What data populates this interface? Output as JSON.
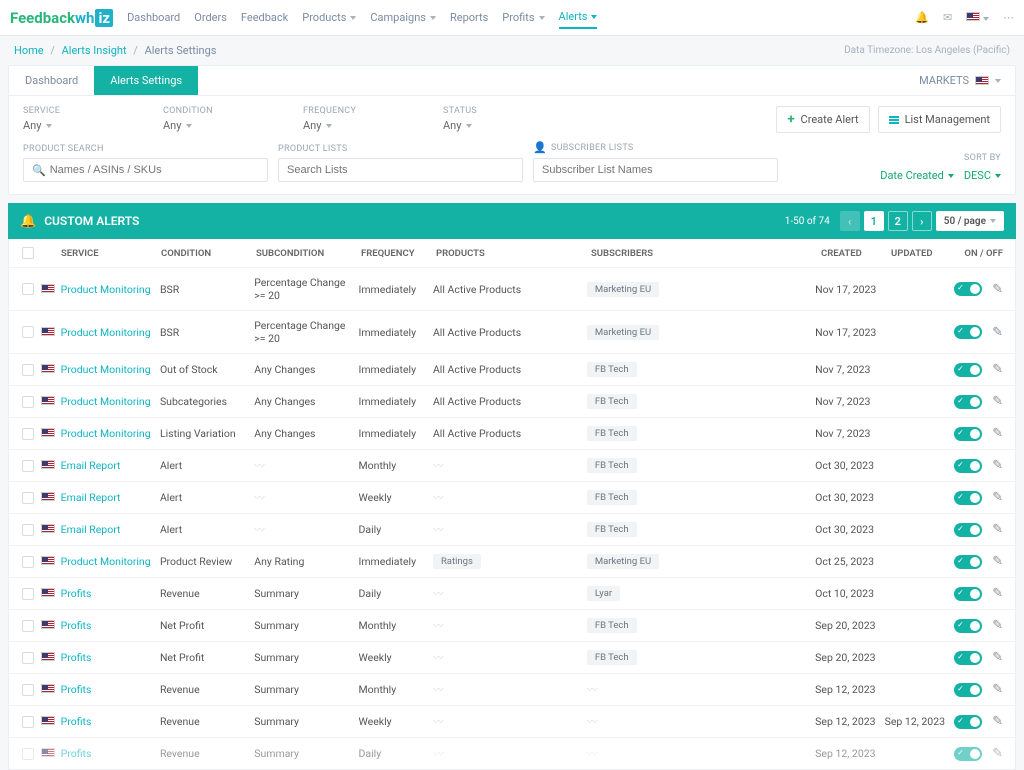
{
  "brand": {
    "part1": "Feedback",
    "part2": "wh",
    "part3": "iz"
  },
  "nav": {
    "items": [
      {
        "label": "Dashboard",
        "caret": false
      },
      {
        "label": "Orders",
        "caret": false
      },
      {
        "label": "Feedback",
        "caret": false
      },
      {
        "label": "Products",
        "caret": true
      },
      {
        "label": "Campaigns",
        "caret": true
      },
      {
        "label": "Reports",
        "caret": false
      },
      {
        "label": "Profits",
        "caret": true
      },
      {
        "label": "Alerts",
        "caret": true,
        "active": true
      }
    ]
  },
  "breadcrumb": {
    "home": "Home",
    "insight": "Alerts Insight",
    "current": "Alerts Settings"
  },
  "timezone": "Data Timezone: Los Angeles (Pacific)",
  "tabs": {
    "dashboard": "Dashboard",
    "settings": "Alerts Settings"
  },
  "markets_label": "MARKETS",
  "filters": {
    "service": {
      "label": "SERVICE",
      "value": "Any"
    },
    "condition": {
      "label": "CONDITION",
      "value": "Any"
    },
    "frequency": {
      "label": "FREQUENCY",
      "value": "Any"
    },
    "status": {
      "label": "STATUS",
      "value": "Any"
    }
  },
  "buttons": {
    "create": "Create Alert",
    "list_mgmt": "List Management"
  },
  "search": {
    "product_label": "PRODUCT SEARCH",
    "product_placeholder": "Names / ASINs / SKUs",
    "lists_label": "PRODUCT LISTS",
    "lists_placeholder": "Search Lists",
    "subs_label": "SUBSCRIBER LISTS",
    "subs_placeholder": "Subscriber List Names",
    "sort_label": "SORT BY",
    "sort_field": "Date Created",
    "sort_dir": "DESC"
  },
  "grid": {
    "title": "CUSTOM ALERTS",
    "range": "1-50 of 74",
    "page1": "1",
    "page2": "2",
    "page_size": "50 / page"
  },
  "columns": {
    "service": "Service",
    "condition": "Condition",
    "subcondition": "Subcondition",
    "frequency": "Frequency",
    "products": "Products",
    "subscribers": "Subscribers",
    "created": "Created",
    "updated": "Updated",
    "onoff": "On / Off"
  },
  "rows": [
    {
      "service": "Product Monitoring",
      "condition": "BSR",
      "sub": "Percentage Change   >= 20",
      "freq": "Immediately",
      "products": "All Active Products",
      "products_chip": false,
      "subs": "Marketing EU",
      "created": "Nov 17, 2023",
      "updated": ""
    },
    {
      "service": "Product Monitoring",
      "condition": "BSR",
      "sub": "Percentage Change   >= 20",
      "freq": "Immediately",
      "products": "All Active Products",
      "products_chip": false,
      "subs": "Marketing EU",
      "created": "Nov 17, 2023",
      "updated": ""
    },
    {
      "service": "Product Monitoring",
      "condition": "Out of Stock",
      "sub": "Any Changes",
      "freq": "Immediately",
      "products": "All Active Products",
      "products_chip": false,
      "subs": "FB Tech",
      "created": "Nov 7, 2023",
      "updated": ""
    },
    {
      "service": "Product Monitoring",
      "condition": "Subcategories",
      "sub": "Any Changes",
      "freq": "Immediately",
      "products": "All Active Products",
      "products_chip": false,
      "subs": "FB Tech",
      "created": "Nov 7, 2023",
      "updated": ""
    },
    {
      "service": "Product Monitoring",
      "condition": "Listing Variation",
      "sub": "Any Changes",
      "freq": "Immediately",
      "products": "All Active Products",
      "products_chip": false,
      "subs": "FB Tech",
      "created": "Nov 7, 2023",
      "updated": ""
    },
    {
      "service": "Email Report",
      "condition": "Alert",
      "sub": "~",
      "sub_tilde": true,
      "freq": "Monthly",
      "products": "~",
      "products_tilde": true,
      "subs": "FB Tech",
      "created": "Oct 30, 2023",
      "updated": ""
    },
    {
      "service": "Email Report",
      "condition": "Alert",
      "sub": "~",
      "sub_tilde": true,
      "freq": "Weekly",
      "products": "~",
      "products_tilde": true,
      "subs": "FB Tech",
      "created": "Oct 30, 2023",
      "updated": ""
    },
    {
      "service": "Email Report",
      "condition": "Alert",
      "sub": "~",
      "sub_tilde": true,
      "freq": "Daily",
      "products": "~",
      "products_tilde": true,
      "subs": "FB Tech",
      "created": "Oct 30, 2023",
      "updated": ""
    },
    {
      "service": "Product Monitoring",
      "condition": "Product Review",
      "sub": "Any Rating",
      "freq": "Immediately",
      "products": "Ratings",
      "products_chip": true,
      "subs": "Marketing EU",
      "created": "Oct 25, 2023",
      "updated": ""
    },
    {
      "service": "Profits",
      "condition": "Revenue",
      "sub": "Summary",
      "freq": "Daily",
      "products": "~",
      "products_tilde": true,
      "subs": "Lyar",
      "created": "Oct 10, 2023",
      "updated": ""
    },
    {
      "service": "Profits",
      "condition": "Net Profit",
      "sub": "Summary",
      "freq": "Monthly",
      "products": "~",
      "products_tilde": true,
      "subs": "FB Tech",
      "created": "Sep 20, 2023",
      "updated": ""
    },
    {
      "service": "Profits",
      "condition": "Net Profit",
      "sub": "Summary",
      "freq": "Weekly",
      "products": "~",
      "products_tilde": true,
      "subs": "FB Tech",
      "created": "Sep 20, 2023",
      "updated": ""
    },
    {
      "service": "Profits",
      "condition": "Revenue",
      "sub": "Summary",
      "freq": "Monthly",
      "products": "~",
      "products_tilde": true,
      "subs": "~",
      "subs_tilde": true,
      "created": "Sep 12, 2023",
      "updated": ""
    },
    {
      "service": "Profits",
      "condition": "Revenue",
      "sub": "Summary",
      "freq": "Weekly",
      "products": "~",
      "products_tilde": true,
      "subs": "~",
      "subs_tilde": true,
      "created": "Sep 12, 2023",
      "updated": "Sep 12, 2023"
    },
    {
      "service": "Profits",
      "condition": "Revenue",
      "sub": "Summary",
      "freq": "Daily",
      "products": "~",
      "products_tilde": true,
      "subs": "~",
      "subs_tilde": true,
      "created": "Sep 12, 2023",
      "updated": ""
    }
  ]
}
